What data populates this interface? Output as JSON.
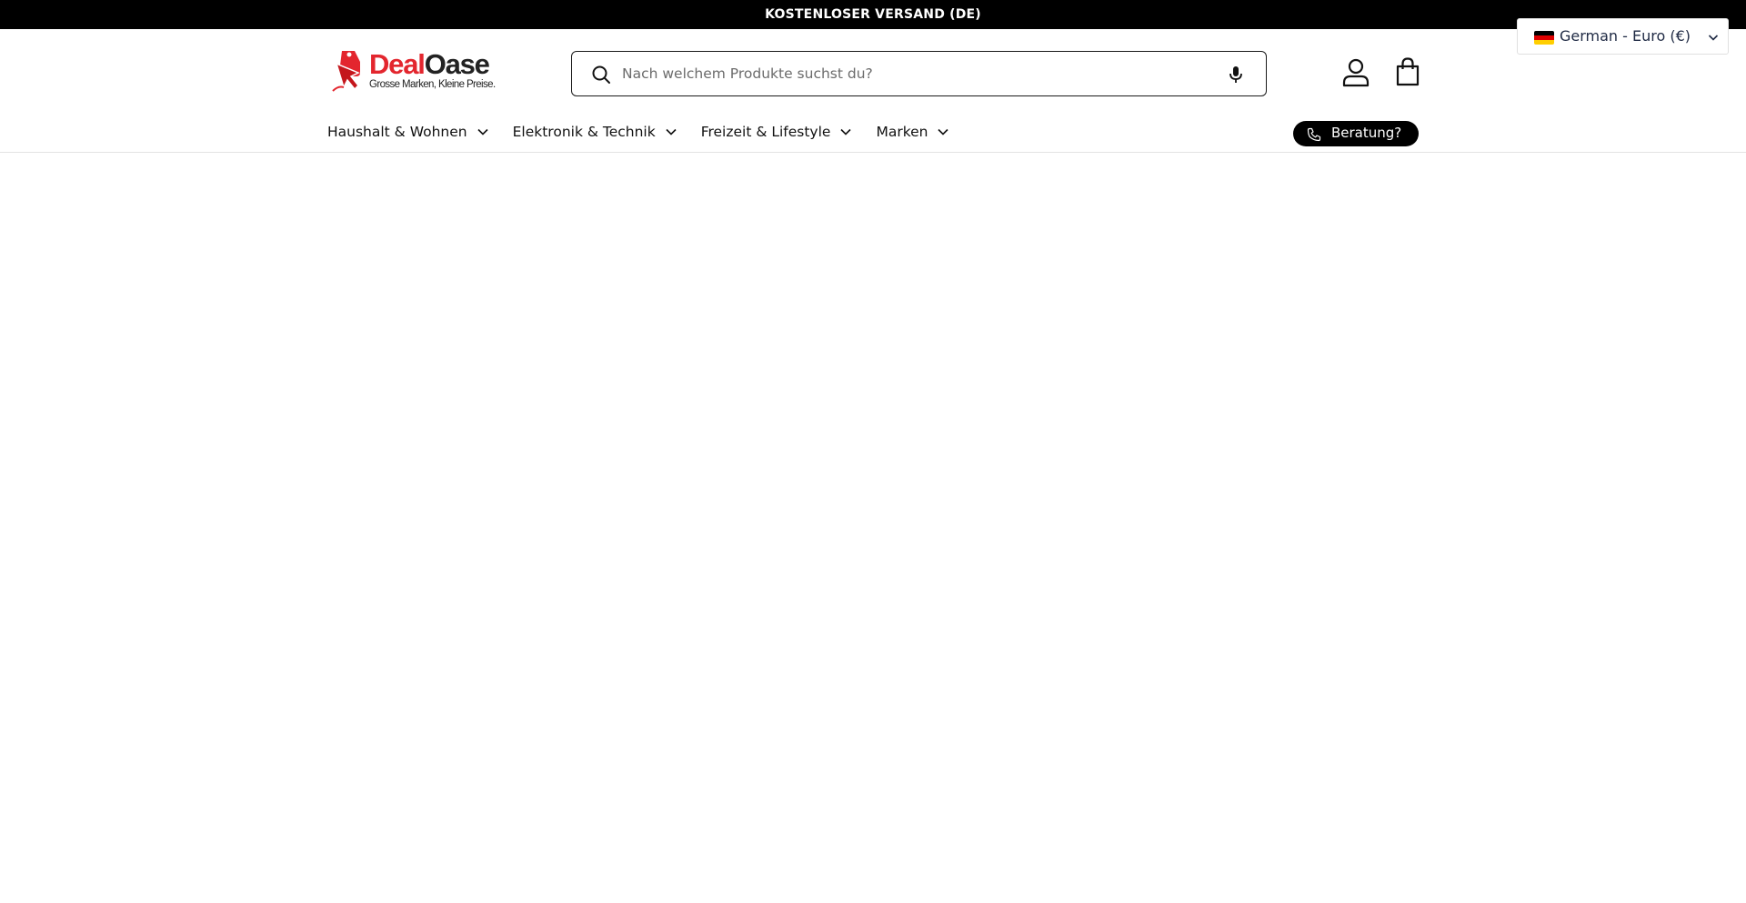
{
  "announcement": {
    "text": "KOSTENLOSER VERSAND (DE)"
  },
  "brand": {
    "name_part1": "Deal",
    "name_part2": "Oase",
    "tagline": "Grosse Marken, Kleine Preise.",
    "primary_color": "#e3262e",
    "dark_color": "#222222"
  },
  "search": {
    "placeholder": "Nach welchem Produkte suchst du?",
    "value": "",
    "icon": "search-icon",
    "voice_icon": "microphone-icon"
  },
  "header_actions": {
    "account_icon": "user-icon",
    "cart_icon": "shopping-bag-icon"
  },
  "localization": {
    "label": "German - Euro (€)",
    "flag": "germany-flag-icon"
  },
  "nav": {
    "items": [
      {
        "label": "Haushalt & Wohnen"
      },
      {
        "label": "Elektronik & Technik"
      },
      {
        "label": "Freizeit & Lifestyle"
      },
      {
        "label": "Marken"
      }
    ]
  },
  "consultation": {
    "label": "Beratung?",
    "icon": "phone-icon"
  },
  "colors": {
    "announcement_bg": "#000000",
    "announcement_text": "#ffffff",
    "button_bg": "#000000",
    "border": "#e3e3e3"
  }
}
